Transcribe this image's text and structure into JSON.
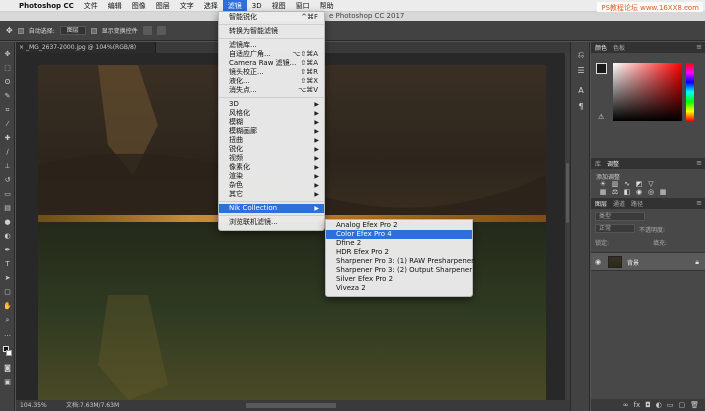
{
  "menubar": {
    "apple": "",
    "items": [
      "Photoshop CC",
      "文件",
      "编辑",
      "图像",
      "图层",
      "文字",
      "选择",
      "滤镜",
      "3D",
      "视图",
      "窗口",
      "帮助"
    ],
    "active_index": 7
  },
  "watermark": "PS教程论坛 www.16XX8.com",
  "window_title": "e Photoshop CC 2017",
  "options": {
    "auto_select": "自动选择:",
    "layer_select": "图层",
    "show_transform": "显示变换控件"
  },
  "document_tab": "_MG_2637-2000.jpg @ 104%(RGB/8)",
  "status": {
    "zoom": "104.35%",
    "doc": "文档:7.63M/7.63M"
  },
  "filter_menu": [
    {
      "label": "智能锐化",
      "shortcut": "^⌘F"
    },
    {
      "sep": true
    },
    {
      "label": "转换为智能滤镜"
    },
    {
      "sep": true
    },
    {
      "label": "滤镜库..."
    },
    {
      "label": "自适应广角...",
      "shortcut": "⌥⇧⌘A"
    },
    {
      "label": "Camera Raw 滤镜...",
      "shortcut": "⇧⌘A"
    },
    {
      "label": "镜头校正...",
      "shortcut": "⇧⌘R"
    },
    {
      "label": "液化...",
      "shortcut": "⇧⌘X"
    },
    {
      "label": "消失点...",
      "shortcut": "⌥⌘V"
    },
    {
      "sep": true
    },
    {
      "label": "3D",
      "arrow": true
    },
    {
      "label": "风格化",
      "arrow": true
    },
    {
      "label": "模糊",
      "arrow": true
    },
    {
      "label": "模糊画廊",
      "arrow": true
    },
    {
      "label": "扭曲",
      "arrow": true
    },
    {
      "label": "锐化",
      "arrow": true
    },
    {
      "label": "视频",
      "arrow": true
    },
    {
      "label": "像素化",
      "arrow": true
    },
    {
      "label": "渲染",
      "arrow": true
    },
    {
      "label": "杂色",
      "arrow": true
    },
    {
      "label": "其它",
      "arrow": true
    },
    {
      "sep": true
    },
    {
      "label": "Nik Collection",
      "arrow": true,
      "highlight": true
    },
    {
      "sep": true
    },
    {
      "label": "浏览联机滤镜..."
    }
  ],
  "nik_submenu": [
    {
      "label": "Analog Efex Pro 2"
    },
    {
      "label": "Color Efex Pro 4",
      "highlight": true
    },
    {
      "label": "Dfine 2"
    },
    {
      "label": "HDR Efex Pro 2"
    },
    {
      "label": "Sharpener Pro 3: (1) RAW Presharpener"
    },
    {
      "label": "Sharpener Pro 3: (2) Output Sharpener"
    },
    {
      "label": "Silver Efex Pro 2"
    },
    {
      "label": "Viveza 2"
    }
  ],
  "panels": {
    "color_tabs": [
      "颜色",
      "色板"
    ],
    "adjust_tabs": [
      "库",
      "调整"
    ],
    "adjust_title": "添加调整",
    "layer_tabs": [
      "图层",
      "通道",
      "路径"
    ],
    "kind_label": "类型",
    "blend_mode": "正常",
    "opacity_label": "不透明度:",
    "lock_label": "锁定:",
    "fill_label": "填充:",
    "layer_name": "背景"
  },
  "icons": {
    "apple": "apple-icon",
    "eye": "eye-icon",
    "lock": "lock-icon"
  }
}
